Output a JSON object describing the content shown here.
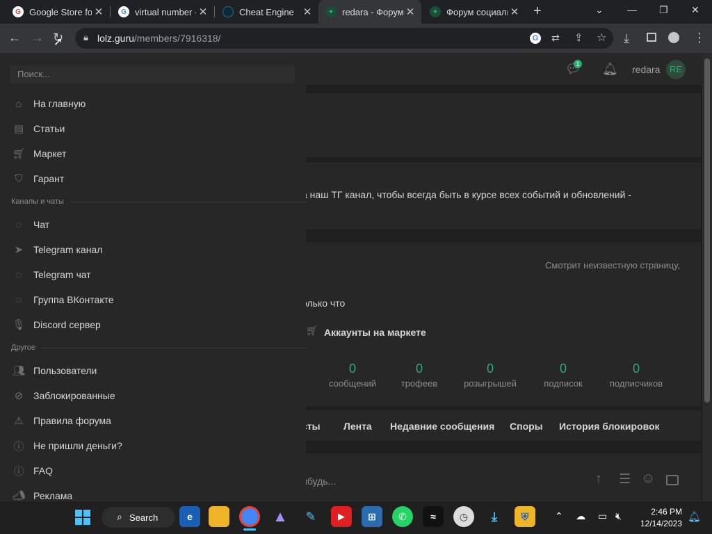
{
  "tabs": [
    {
      "title": "Google Store for",
      "close": "✕"
    },
    {
      "title": "virtual number -",
      "close": "✕"
    },
    {
      "title": "Cheat Engine",
      "close": "✕"
    },
    {
      "title": "redara - Форум",
      "close": "✕"
    },
    {
      "title": "Форум социаль",
      "close": "✕"
    }
  ],
  "new_tab": "+",
  "address": {
    "host": "lolz.guru",
    "path": "/members/7916318/"
  },
  "header": {
    "notif_count": "1",
    "username": "redara",
    "avatar_initials": "RE"
  },
  "page": {
    "banner_text": "а наш ТГ канал, чтобы всегда быть в курсе всех событий и обновлений -",
    "status_text": "Смотрит неизвестную страницу,",
    "time_text": "олько что",
    "market_label": "Аккаунты на маркете",
    "stats": [
      {
        "value": "0",
        "label": "сообщений"
      },
      {
        "value": "0",
        "label": "трофеев"
      },
      {
        "value": "0",
        "label": "розыгрышей"
      },
      {
        "value": "0",
        "label": "подписок"
      },
      {
        "value": "0",
        "label": "подписчиков"
      }
    ],
    "tabs": [
      "сты",
      "Лента",
      "Недавние сообщения",
      "Споры",
      "История блокировок"
    ],
    "composer_placeholder": "ибудь..."
  },
  "sidebar": {
    "search_placeholder": "Поиск...",
    "main_items": [
      "На главную",
      "Статьи",
      "Маркет",
      "Гарант"
    ],
    "section_channels": "Каналы и чаты",
    "channel_items": [
      "Чат",
      "Telegram канал",
      "Telegram чат",
      "Группа ВКонтакте",
      "Discord сервер"
    ],
    "section_other": "Другое",
    "other_items": [
      "Пользователи",
      "Заблокированные",
      "Правила форума",
      "Не пришли деньги?",
      "FAQ",
      "Реклама"
    ]
  },
  "taskbar": {
    "search_label": "Search",
    "time": "2:46 PM",
    "date": "12/14/2023"
  },
  "colors": {
    "accent_green": "#2bad72",
    "sidebar_bg": "#272727",
    "page_bg": "#1f1f1f"
  }
}
